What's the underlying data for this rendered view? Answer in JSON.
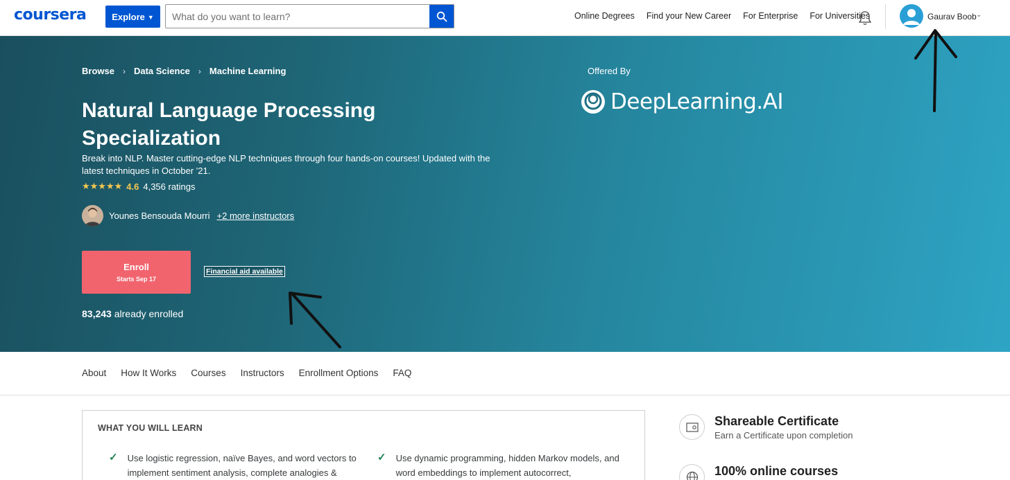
{
  "header": {
    "logo": "coursera",
    "explore_label": "Explore",
    "search_placeholder": "What do you want to learn?",
    "nav_links": [
      "Online Degrees",
      "Find your New Career",
      "For Enterprise",
      "For Universities"
    ],
    "user_name": "Gaurav Boob"
  },
  "hero": {
    "breadcrumb": [
      "Browse",
      "Data Science",
      "Machine Learning"
    ],
    "title": "Natural Language Processing Specialization",
    "description": "Break into NLP. Master cutting-edge NLP techniques through four hands-on courses! Updated with the latest techniques in October '21.",
    "rating_value": "4.6",
    "rating_count": "4,356 ratings",
    "instructor_name": "Younes Bensouda Mourri",
    "more_instructors": "+2 more instructors",
    "enroll_label": "Enroll",
    "enroll_sub": "Starts Sep 17",
    "financial_aid": "Financial aid available",
    "enrolled_count": "83,243",
    "enrolled_suffix": "already enrolled",
    "offered_by_label": "Offered By",
    "partner_name": "DeepLearning.AI"
  },
  "section_nav": [
    "About",
    "How It Works",
    "Courses",
    "Instructors",
    "Enrollment Options",
    "FAQ"
  ],
  "learn": {
    "heading": "WHAT YOU WILL LEARN",
    "items": [
      "Use logistic regression, naïve Bayes, and word vectors to implement sentiment analysis, complete analogies &",
      "Use dynamic programming, hidden Markov models, and word embeddings to implement autocorrect,"
    ]
  },
  "features": [
    {
      "title": "Shareable Certificate",
      "subtitle": "Earn a Certificate upon completion",
      "icon": "certificate-icon"
    },
    {
      "title": "100% online courses",
      "subtitle": "",
      "icon": "globe-icon"
    }
  ],
  "colors": {
    "brand_blue": "#0056d2",
    "enroll_red": "#f1646e",
    "star_gold": "#f5c84f",
    "check_green": "#1f8354"
  }
}
